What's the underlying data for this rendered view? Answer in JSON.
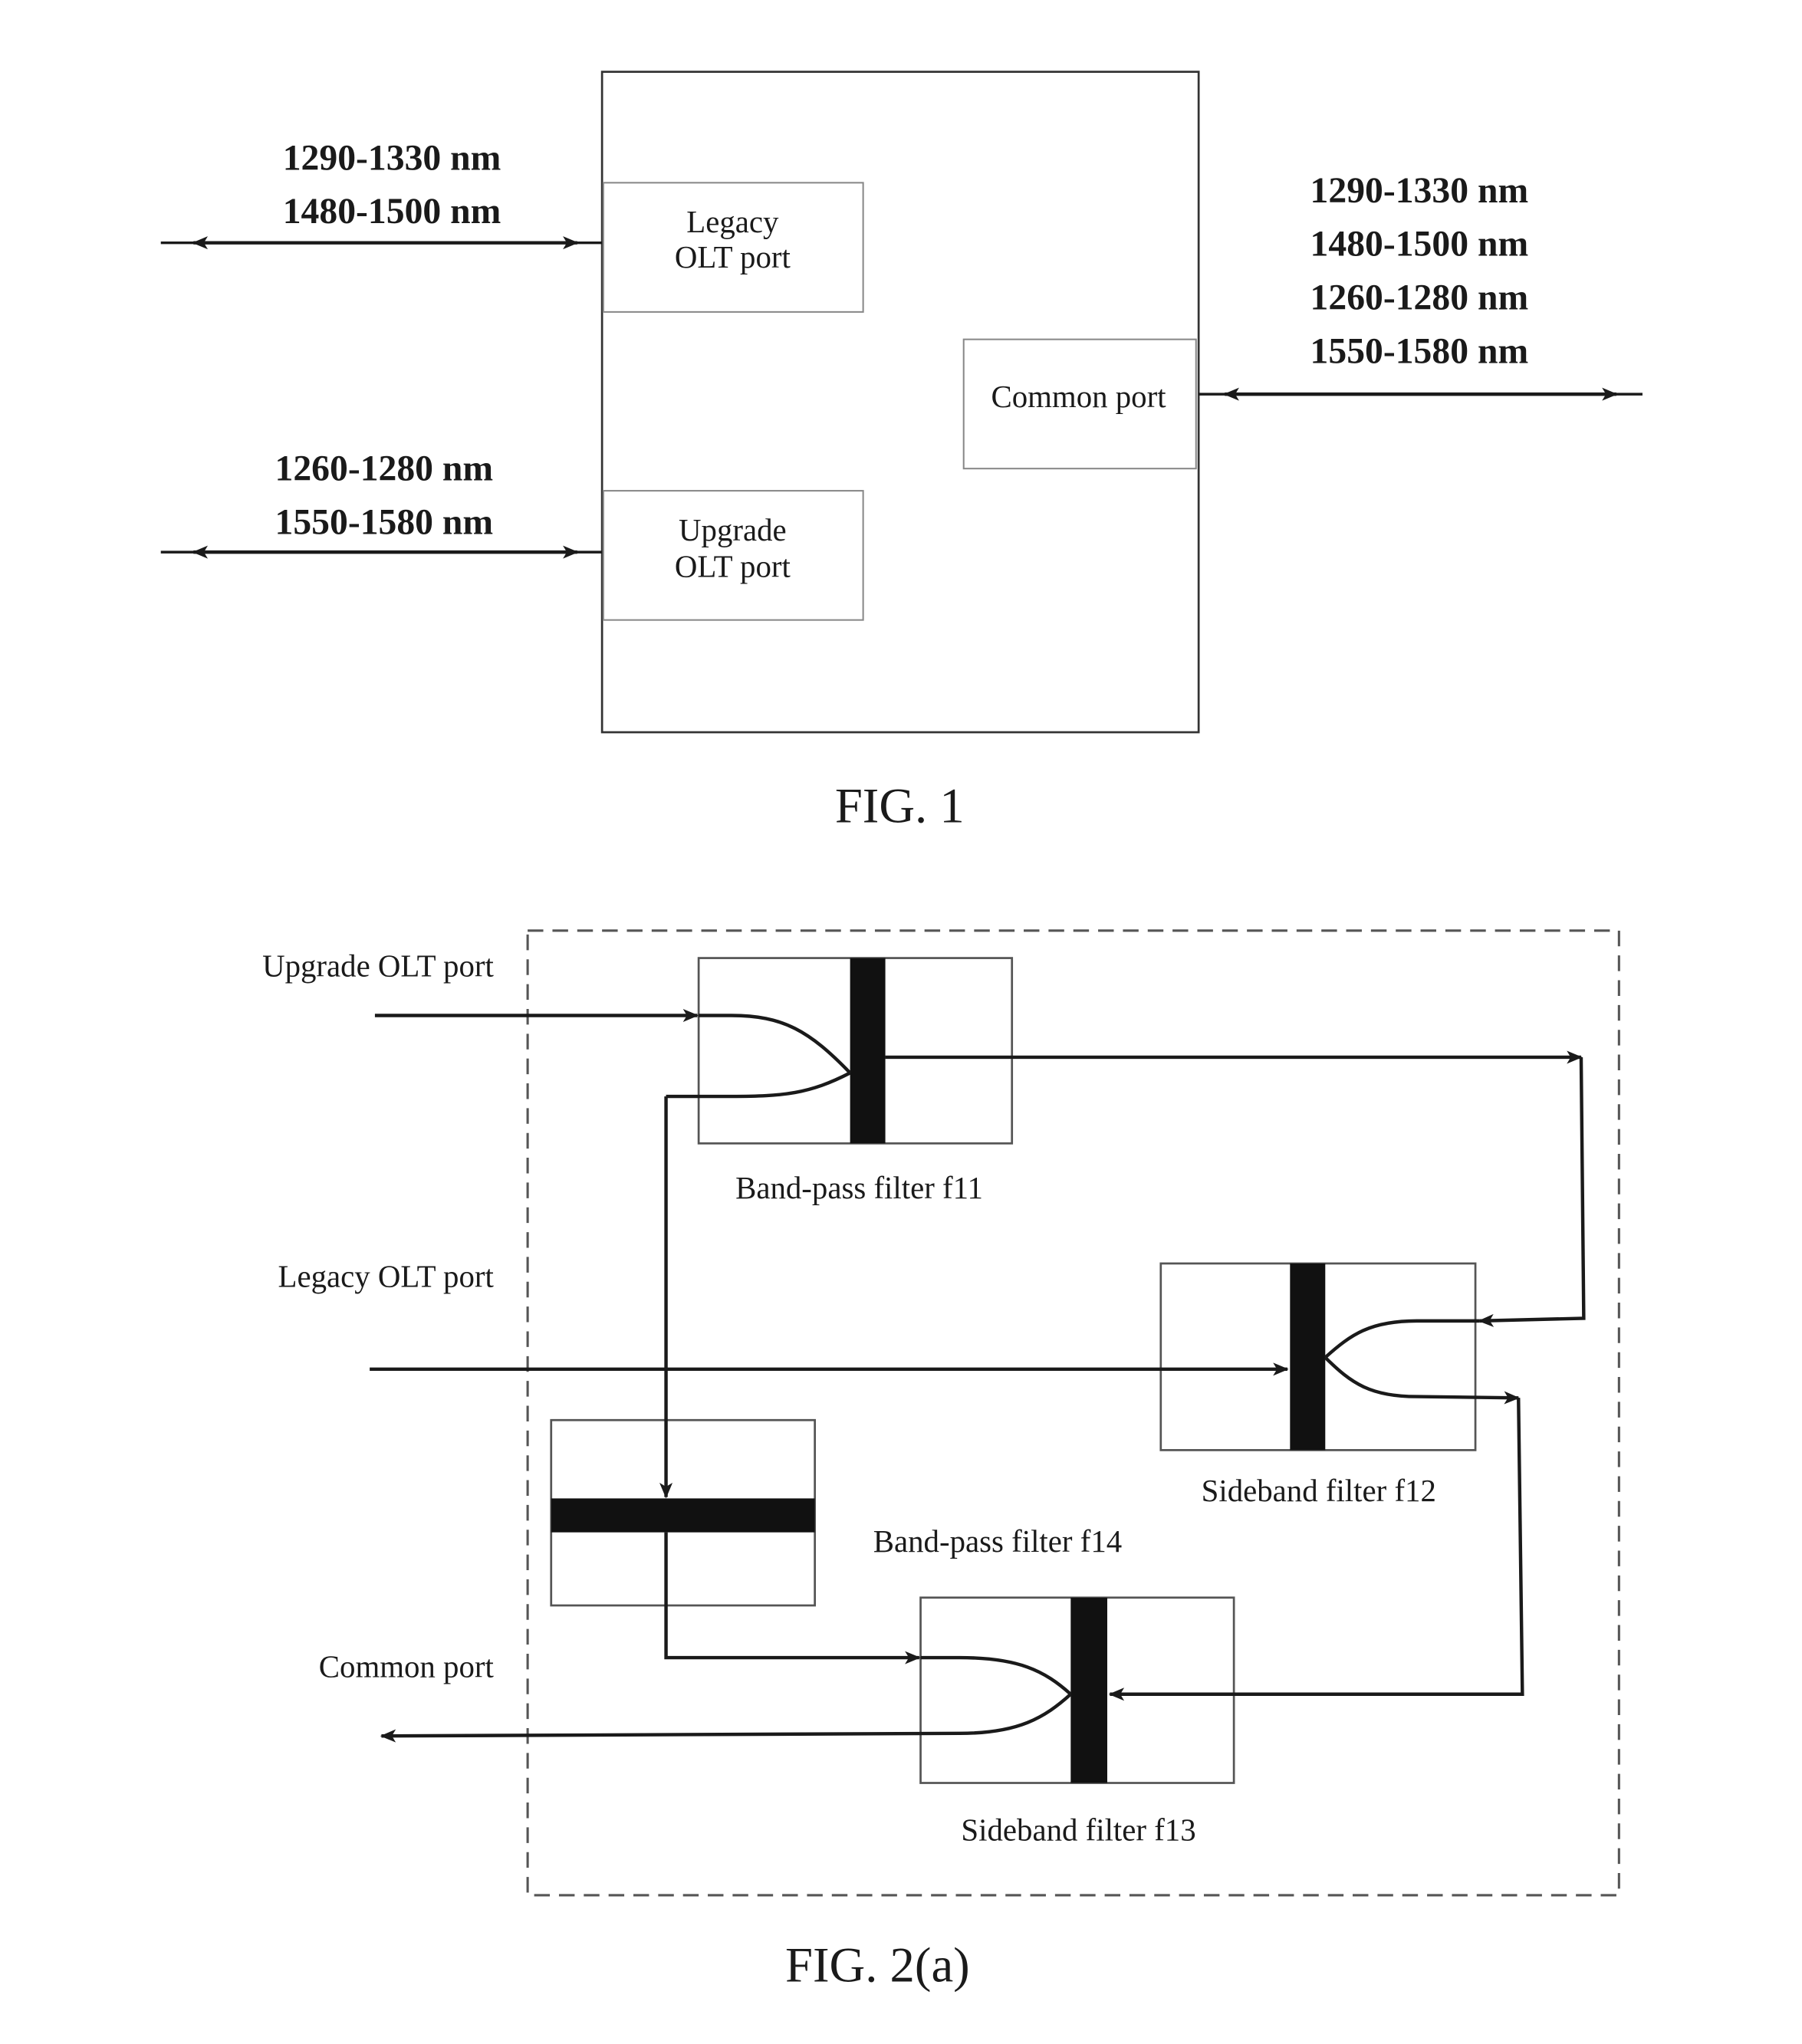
{
  "fig1": {
    "caption": "FIG. 1",
    "legacy_port_lines": [
      "Legacy",
      "OLT port"
    ],
    "upgrade_port_lines": [
      "Upgrade",
      "OLT port"
    ],
    "common_port": "Common port",
    "legacy_wavelengths": [
      "1290-1330 nm",
      "1480-1500 nm"
    ],
    "upgrade_wavelengths": [
      "1260-1280 nm",
      "1550-1580 nm"
    ],
    "common_wavelengths": [
      "1290-1330 nm",
      "1480-1500 nm",
      "1260-1280 nm",
      "1550-1580 nm"
    ]
  },
  "fig2": {
    "caption": "FIG. 2(a)",
    "upgrade_port": "Upgrade OLT port",
    "legacy_port": "Legacy OLT port",
    "common_port": "Common port",
    "filters": {
      "f11": "Band-pass filter f11",
      "f12": "Sideband filter f12",
      "f13": "Sideband filter f13",
      "f14": "Band-pass filter f14"
    }
  }
}
